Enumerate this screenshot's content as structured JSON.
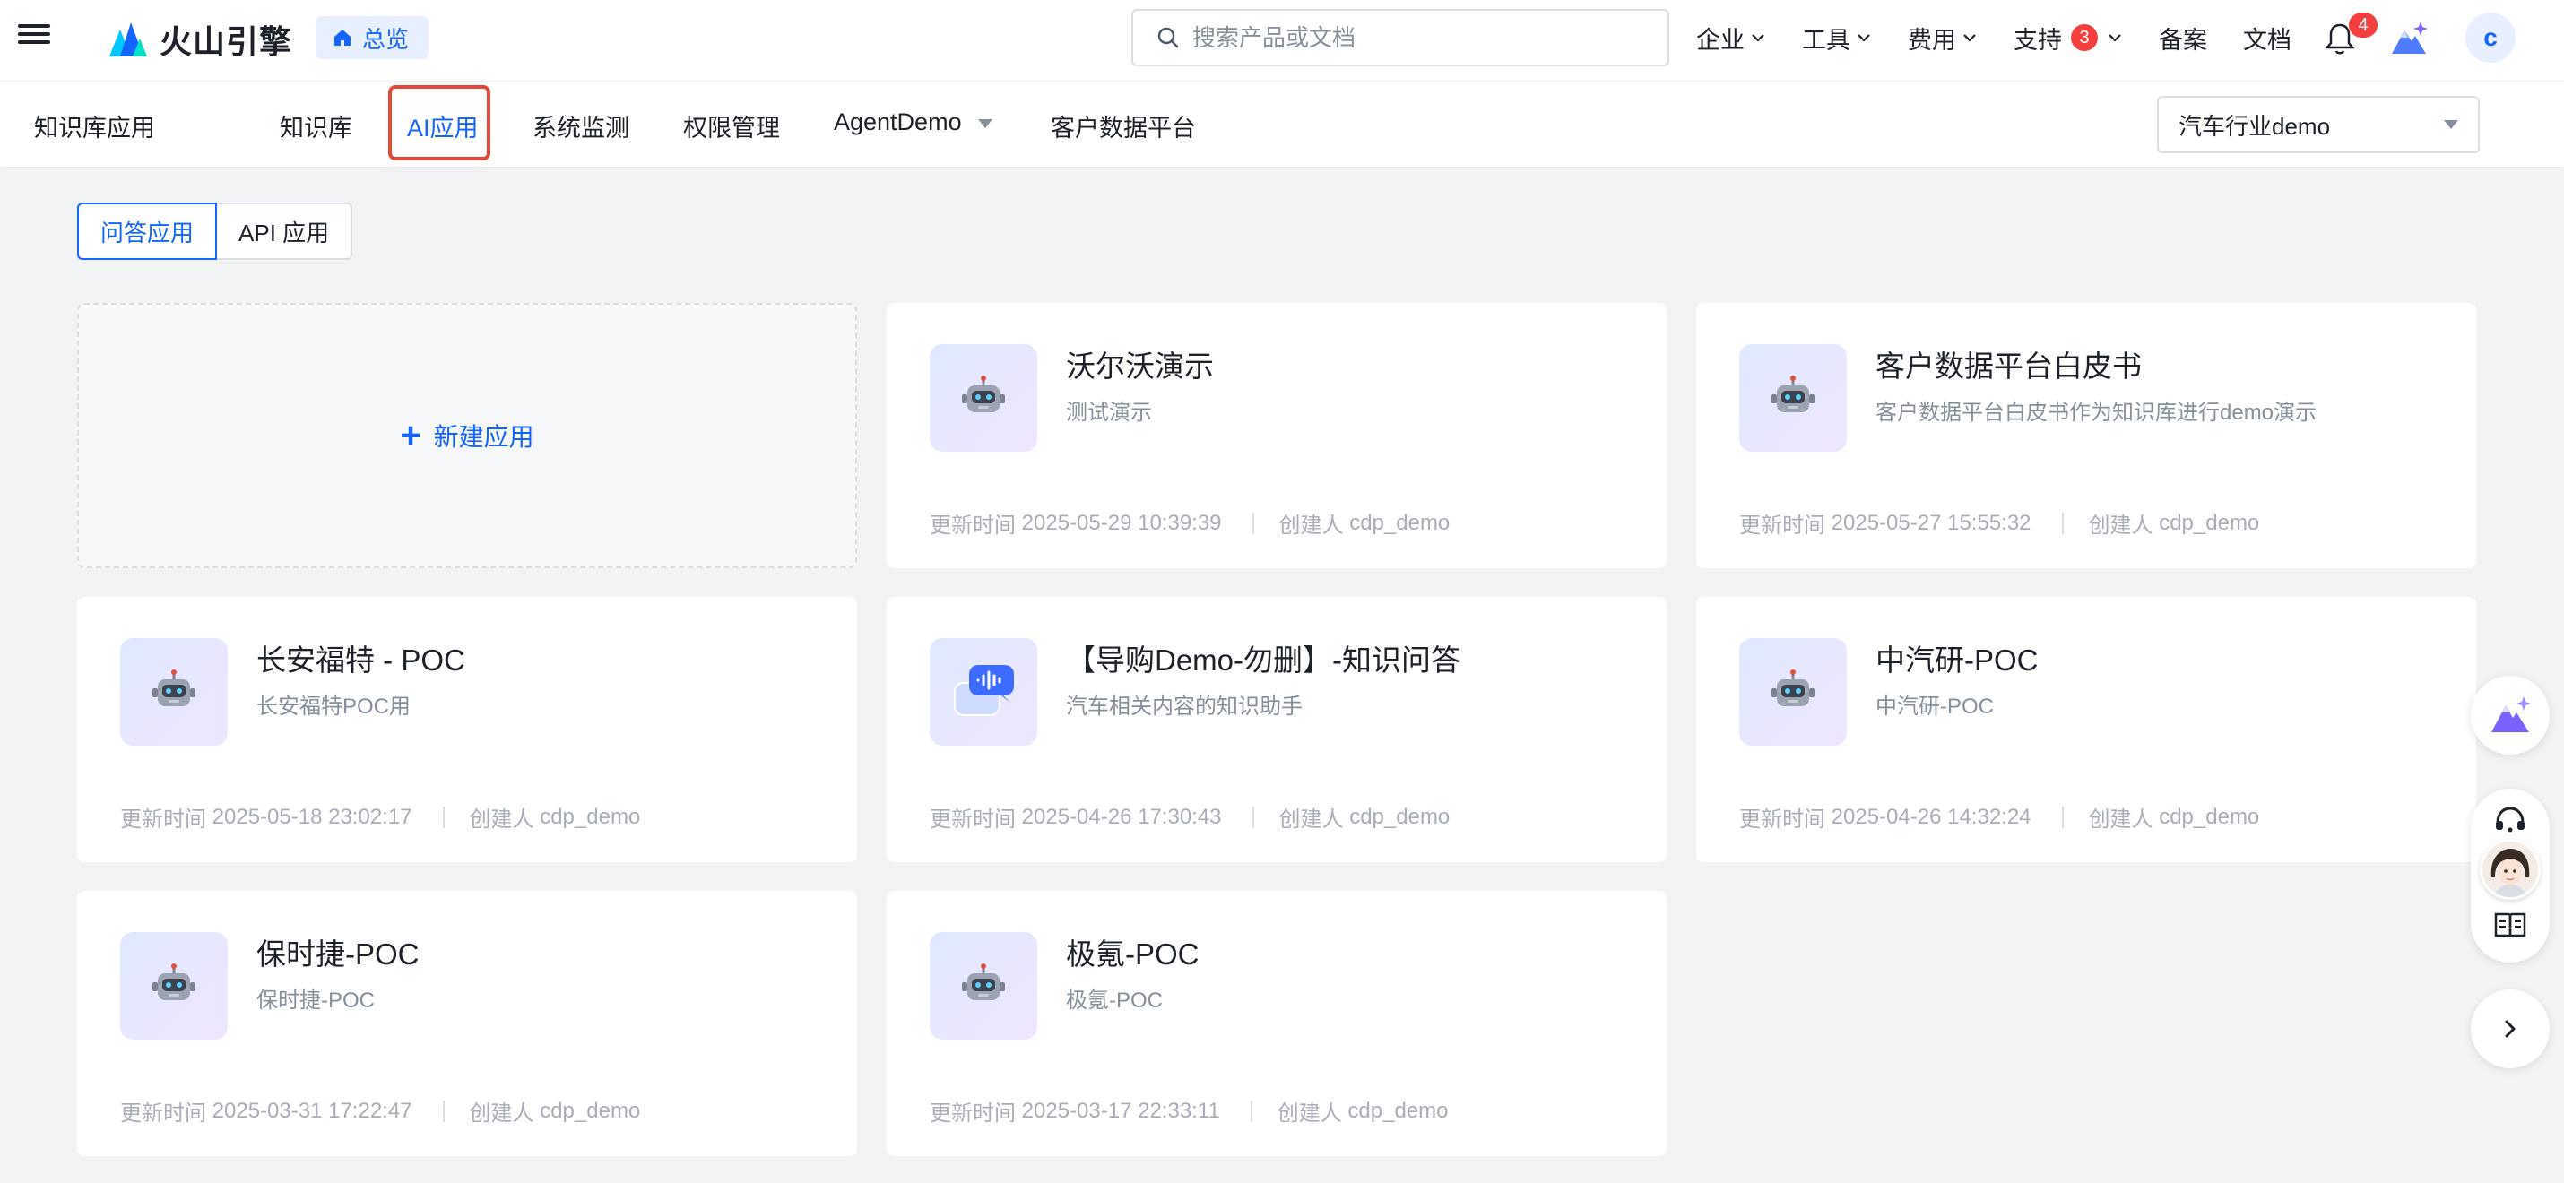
{
  "header": {
    "logo_text": "火山引擎",
    "home_chip": "总览",
    "search_placeholder": "搜索产品或文档",
    "menu": [
      {
        "label": "企业"
      },
      {
        "label": "工具"
      },
      {
        "label": "费用"
      },
      {
        "label": "支持",
        "badge": "3"
      },
      {
        "label": "备案"
      },
      {
        "label": "文档"
      }
    ],
    "notification_count": "4",
    "avatar_letter": "c"
  },
  "subnav": {
    "app_name": "知识库应用",
    "items": [
      {
        "label": "知识库"
      },
      {
        "label": "AI应用"
      },
      {
        "label": "系统监测"
      },
      {
        "label": "权限管理"
      },
      {
        "label": "AgentDemo"
      },
      {
        "label": "客户数据平台"
      }
    ],
    "active_item": "AI应用",
    "knowledge_select": "汽车行业demo"
  },
  "tabs": {
    "items": [
      "问答应用",
      "API 应用"
    ],
    "active": "问答应用"
  },
  "new_app_label": "新建应用",
  "meta_labels": {
    "updated": "更新时间",
    "creator": "创建人"
  },
  "apps": [
    {
      "title": "沃尔沃演示",
      "desc": "测试演示",
      "updated": "2025-05-29 10:39:39",
      "creator": "cdp_demo",
      "icon": "robot-icon"
    },
    {
      "title": "客户数据平台白皮书",
      "desc": "客户数据平台白皮书作为知识库进行demo演示",
      "updated": "2025-05-27 15:55:32",
      "creator": "cdp_demo",
      "icon": "robot-icon"
    },
    {
      "title": "长安福特 - POC",
      "desc": "长安福特POC用",
      "updated": "2025-05-18 23:02:17",
      "creator": "cdp_demo",
      "icon": "robot-icon"
    },
    {
      "title": "【导购Demo-勿删】-知识问答",
      "desc": "汽车相关内容的知识助手",
      "updated": "2025-04-26 17:30:43",
      "creator": "cdp_demo",
      "icon": "chat-bubble-icon"
    },
    {
      "title": "中汽研-POC",
      "desc": "中汽研-POC",
      "updated": "2025-04-26 14:32:24",
      "creator": "cdp_demo",
      "icon": "robot-icon"
    },
    {
      "title": "保时捷-POC",
      "desc": "保时捷-POC",
      "updated": "2025-03-31 17:22:47",
      "creator": "cdp_demo",
      "icon": "robot-icon"
    },
    {
      "title": "极氪-POC",
      "desc": "极氪-POC",
      "updated": "2025-03-17 22:33:11",
      "creator": "cdp_demo",
      "icon": "robot-icon"
    }
  ],
  "colors": {
    "accent": "#1664ff",
    "highlight_outline": "#e34a3a",
    "badge": "#f53f3f",
    "page_bg": "#f2f3f5"
  }
}
